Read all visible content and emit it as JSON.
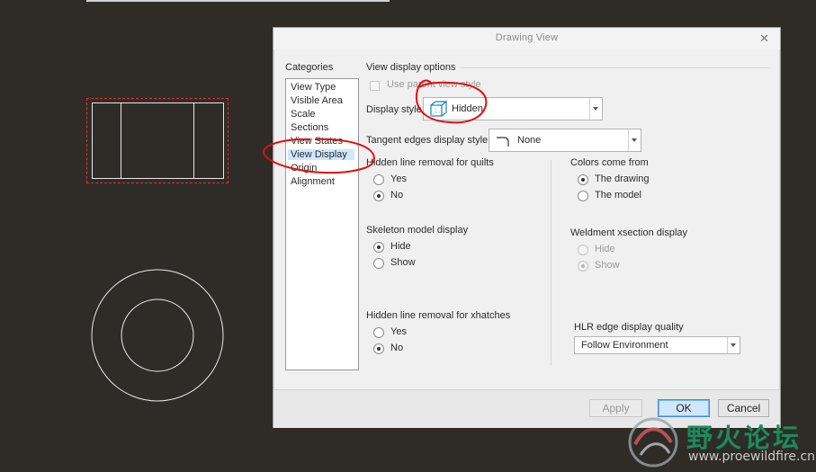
{
  "dialog": {
    "title": "Drawing View",
    "close_icon": "close-icon"
  },
  "categories": {
    "label": "Categories",
    "items": [
      {
        "label": "View Type"
      },
      {
        "label": "Visible Area"
      },
      {
        "label": "Scale"
      },
      {
        "label": "Sections"
      },
      {
        "label": "View States"
      },
      {
        "label": "View Display",
        "selected": true
      },
      {
        "label": "Origin"
      },
      {
        "label": "Alignment"
      }
    ]
  },
  "options": {
    "section_title": "View display options",
    "use_parent_view_style": {
      "label": "Use parent view style",
      "checked": false,
      "enabled": false
    },
    "display_style": {
      "label": "Display style",
      "value": "Hidden",
      "icon": "hidden-style-icon"
    },
    "tangent_edges": {
      "label": "Tangent edges display style",
      "value": "None",
      "icon": "tangent-edge-icon"
    },
    "hidden_line_quilts": {
      "label": "Hidden line removal for quilts",
      "options": [
        "Yes",
        "No"
      ],
      "selected": "No"
    },
    "skeleton_display": {
      "label": "Skeleton model display",
      "options": [
        "Hide",
        "Show"
      ],
      "selected": "Hide"
    },
    "hidden_line_xhatches": {
      "label": "Hidden line removal for xhatches",
      "options": [
        "Yes",
        "No"
      ],
      "selected": "No"
    },
    "colors_from": {
      "label": "Colors come from",
      "options": [
        "The drawing",
        "The model"
      ],
      "selected": "The drawing"
    },
    "weldment_xsection": {
      "label": "Weldment xsection display",
      "options": [
        "Hide",
        "Show"
      ],
      "selected": "Show",
      "enabled": false
    },
    "hlr_quality": {
      "label": "HLR edge display quality",
      "value": "Follow Environment"
    }
  },
  "buttons": {
    "apply": "Apply",
    "ok": "OK",
    "cancel": "Cancel"
  },
  "watermark": {
    "chinese": "野火论坛",
    "url": "www.proewildfire.cn"
  },
  "colors": {
    "canvas_bg": "#2f2c28",
    "annotation_red": "#e01010",
    "selection_bg": "#cde8ff",
    "watermark_green": "#1e8a5b"
  }
}
